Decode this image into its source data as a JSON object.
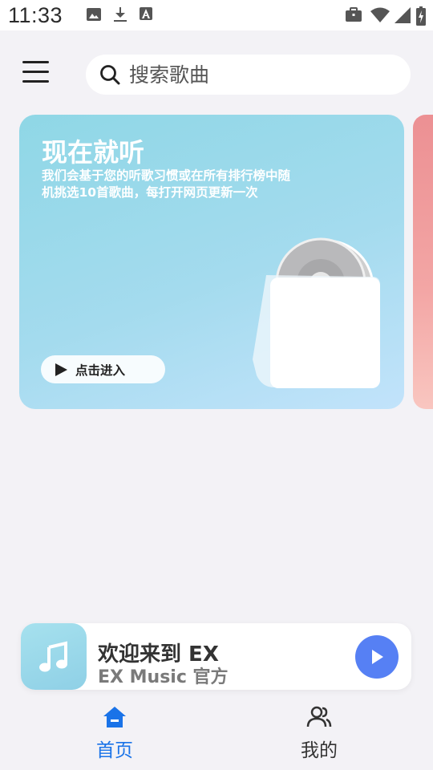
{
  "status_bar": {
    "time": "11:33",
    "left_icons": [
      "image-icon",
      "download-icon",
      "font-icon"
    ],
    "right_icons": [
      "briefcase-icon",
      "wifi-icon",
      "signal-icon",
      "battery-icon"
    ]
  },
  "header": {
    "search_placeholder": "搜索歌曲"
  },
  "banner": {
    "title": "现在就听",
    "description": "我们会基于您的听歌习惯或在所有排行榜中随机挑选10首歌曲，每打开网页更新一次",
    "button_label": "点击进入"
  },
  "player": {
    "track_title": "欢迎来到 EX",
    "track_artist": "EX Music 官方"
  },
  "bottom_nav": {
    "items": [
      {
        "label": "首页",
        "icon": "home-icon",
        "active": true
      },
      {
        "label": "我的",
        "icon": "profile-icon",
        "active": false
      }
    ]
  },
  "colors": {
    "accent": "#1a73e8",
    "play_button": "#5680f4",
    "banner_start": "#8fd7e6",
    "banner_end": "#c2e3fb",
    "background": "#f3f2f6"
  }
}
